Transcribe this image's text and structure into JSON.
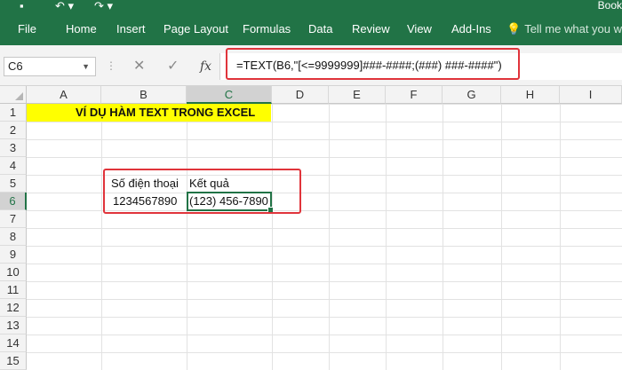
{
  "window": {
    "title_partial": "Book"
  },
  "ribbon": {
    "tabs": [
      "File",
      "Home",
      "Insert",
      "Page Layout",
      "Formulas",
      "Data",
      "Review",
      "View",
      "Add-Ins"
    ],
    "tell_me": "Tell me what you wa"
  },
  "formula_bar": {
    "name_box": "C6",
    "cancel_icon": "✕",
    "enter_icon": "✓",
    "fx_label": "fx",
    "formula": "=TEXT(B6,\"[<=9999999]###-####;(###) ###-####\")"
  },
  "sheet": {
    "columns": [
      "A",
      "B",
      "C",
      "D",
      "E",
      "F",
      "G",
      "H",
      "I"
    ],
    "rows": [
      "1",
      "2",
      "3",
      "4",
      "5",
      "6",
      "7",
      "8",
      "9",
      "10",
      "11",
      "12",
      "13",
      "14",
      "15"
    ],
    "cells": {
      "A1": "VÍ DỤ HÀM TEXT TRONG EXCEL",
      "B5": "Số điện thoại",
      "C5": "Kết quả",
      "B6": "1234567890",
      "C6": "(123) 456-7890"
    },
    "selected_cell": "C6",
    "highlight_color": "#ffff00"
  },
  "colors": {
    "ribbon_green": "#217346",
    "annotation_red": "#e0343b"
  }
}
